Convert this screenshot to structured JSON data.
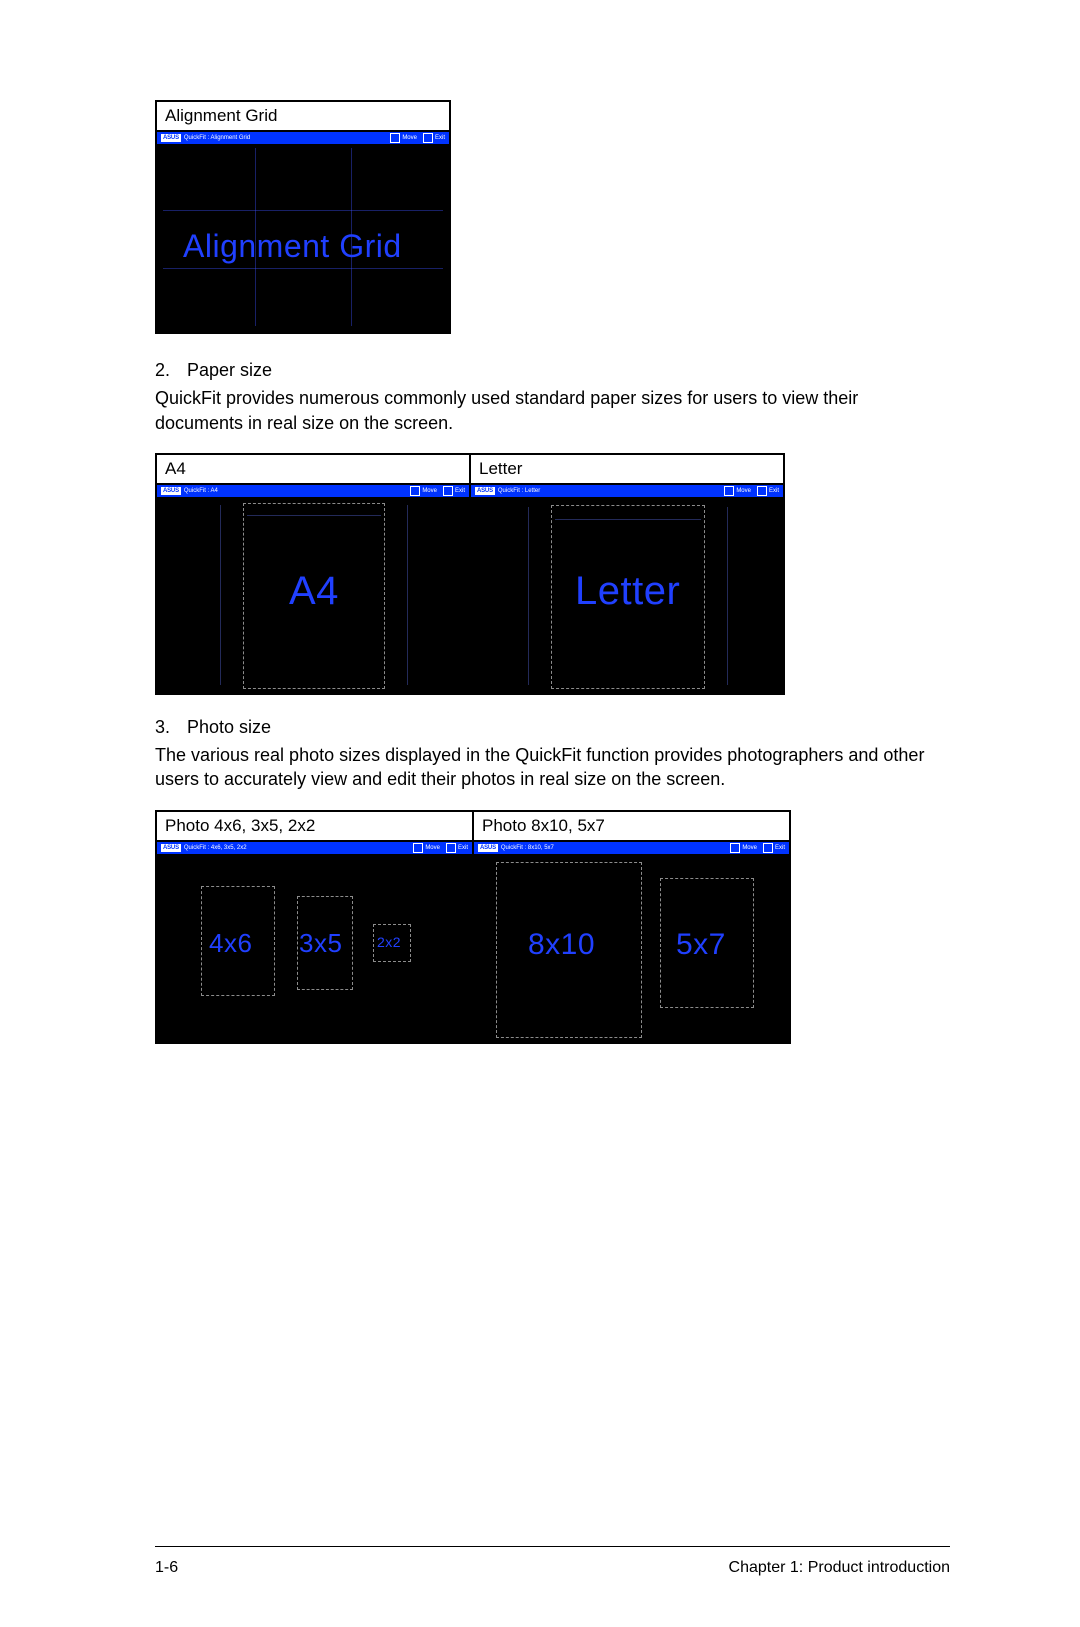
{
  "osd": {
    "brand": "ASUS",
    "alignment_title": "QuickFit : Alignment Grid",
    "a4_title": "QuickFit : A4",
    "letter_title": "QuickFit : Letter",
    "photo1_title": "QuickFit : 4x6, 3x5, 2x2",
    "photo2_title": "QuickFit : 8x10, 5x7",
    "move": "Move",
    "exit": "Exit"
  },
  "section1": {
    "caption": "Alignment Grid",
    "screen_label": "Alignment Grid"
  },
  "section2": {
    "num": "2.",
    "title": "Paper size",
    "body": "QuickFit provides numerous commonly used standard paper sizes for users to view their documents in real size on the screen.",
    "caption_left": "A4",
    "caption_right": "Letter",
    "label_left": "A4",
    "label_right": "Letter"
  },
  "section3": {
    "num": "3.",
    "title": "Photo size",
    "body": "The various real photo sizes displayed in the QuickFit function provides photographers and other users to accurately view and edit their photos in real size on the screen.",
    "caption_left": "Photo 4x6, 3x5, 2x2",
    "caption_right": "Photo 8x10, 5x7",
    "label_4x6": "4x6",
    "label_3x5": "3x5",
    "label_2x2": "2x2",
    "label_8x10": "8x10",
    "label_5x7": "5x7"
  },
  "footer": {
    "page_num": "1-6",
    "chapter": "Chapter 1: Product introduction"
  }
}
